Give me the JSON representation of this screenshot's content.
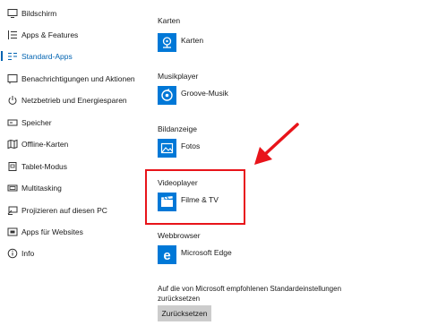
{
  "sidebar": {
    "items": [
      {
        "label": "Bildschirm",
        "icon": "monitor-icon"
      },
      {
        "label": "Apps & Features",
        "icon": "apps-list-icon"
      },
      {
        "label": "Standard-Apps",
        "icon": "default-apps-icon",
        "active": true
      },
      {
        "label": "Benachrichtigungen und Aktionen",
        "icon": "notification-icon"
      },
      {
        "label": "Netzbetrieb und Energiesparen",
        "icon": "power-icon"
      },
      {
        "label": "Speicher",
        "icon": "storage-icon"
      },
      {
        "label": "Offline-Karten",
        "icon": "map-icon"
      },
      {
        "label": "Tablet-Modus",
        "icon": "tablet-icon"
      },
      {
        "label": "Multitasking",
        "icon": "multitasking-icon"
      },
      {
        "label": "Projizieren auf diesen PC",
        "icon": "project-icon"
      },
      {
        "label": "Apps für Websites",
        "icon": "web-apps-icon"
      },
      {
        "label": "Info",
        "icon": "info-icon"
      }
    ]
  },
  "main": {
    "sections": [
      {
        "label": "Karten",
        "app": "Karten",
        "icon": "maps-app-icon"
      },
      {
        "label": "Musikplayer",
        "app": "Groove-Musik",
        "icon": "groove-music-icon"
      },
      {
        "label": "Bildanzeige",
        "app": "Fotos",
        "icon": "photos-icon"
      },
      {
        "label": "Videoplayer",
        "app": "Filme & TV",
        "icon": "movies-tv-icon"
      },
      {
        "label": "Webbrowser",
        "app": "Microsoft Edge",
        "icon": "edge-icon"
      }
    ],
    "reset": {
      "description": "Auf die von Microsoft empfohlenen Standardeinstellungen zurücksetzen",
      "button_label": "Zurücksetzen"
    }
  },
  "colors": {
    "accent": "#0063b1",
    "app_tile": "#0078d7",
    "highlight": "#e8141a",
    "button_bg": "#cccccc"
  }
}
